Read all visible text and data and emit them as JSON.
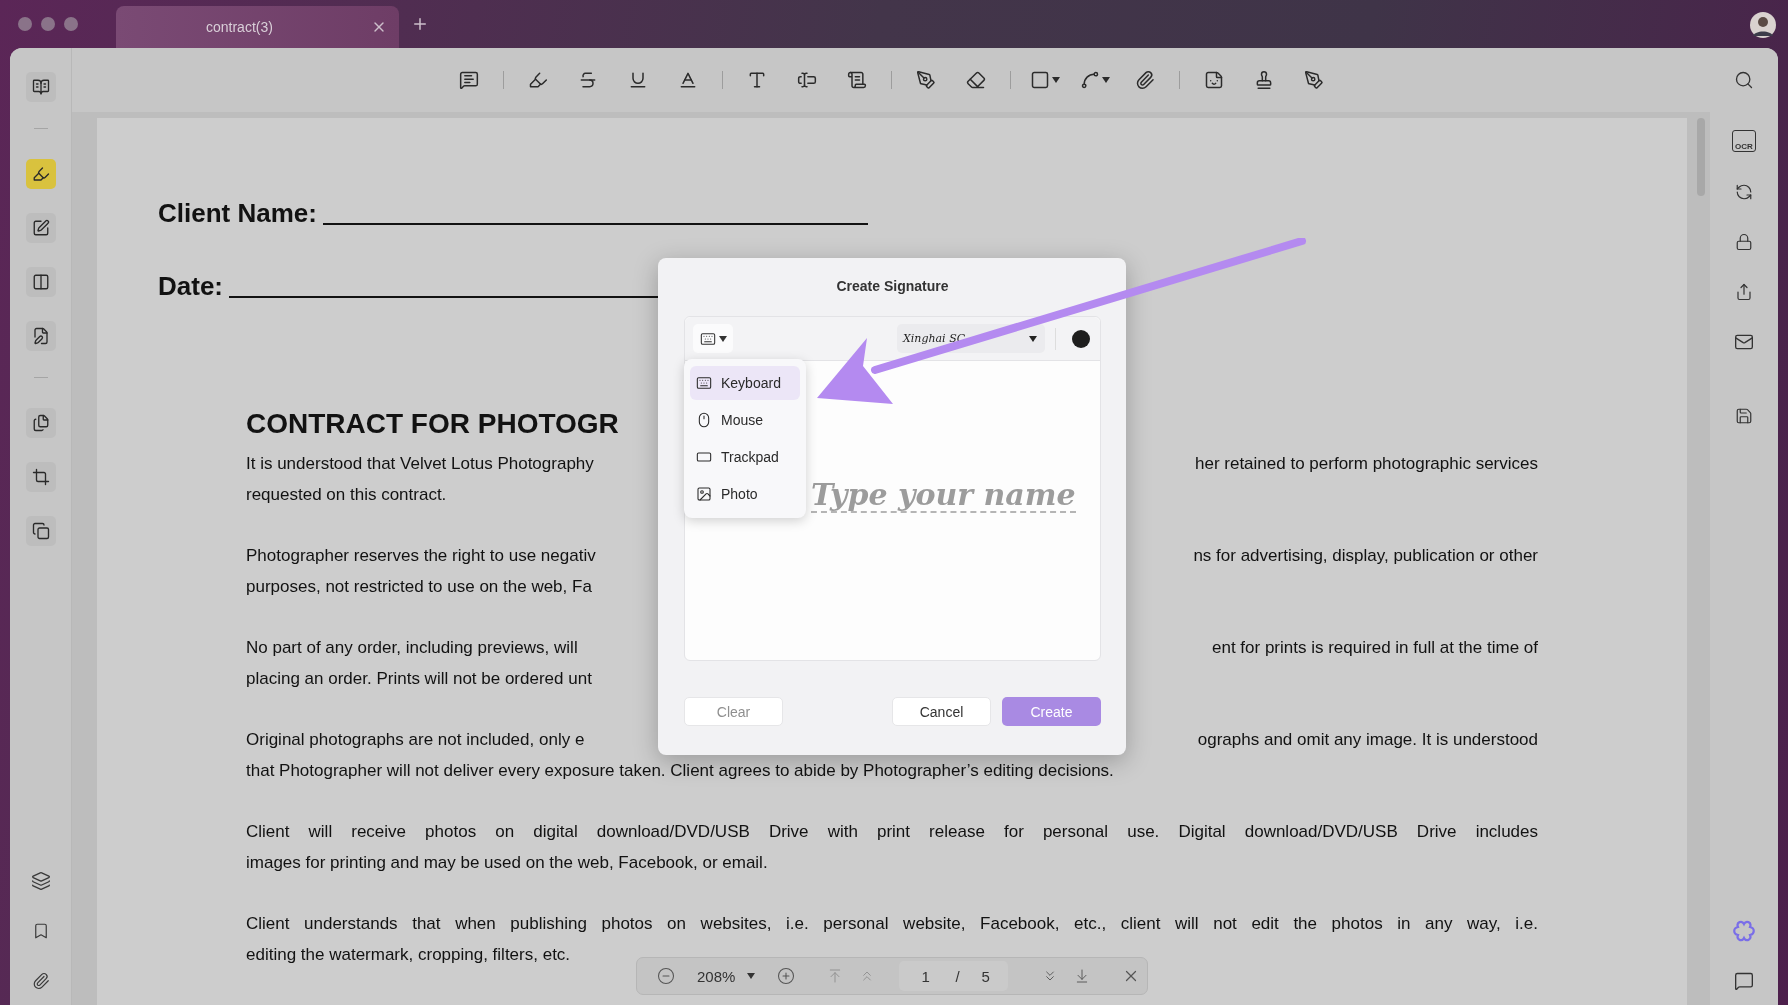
{
  "tab": {
    "title": "contract(3)"
  },
  "left_tools": [
    {
      "selected": false
    },
    {
      "selected": true
    },
    {
      "selected": false
    },
    {
      "selected": false
    },
    {
      "selected": false
    },
    {
      "selected": false
    },
    {
      "selected": false
    },
    {
      "selected": false
    }
  ],
  "document": {
    "fields": [
      {
        "label": "Client Name:"
      },
      {
        "label": "Date:"
      }
    ],
    "heading": "CONTRACT FOR PHOTOGR",
    "paragraphs": [
      {
        "lines": [
          {
            "left": "It is understood that Velvet Lotus Photography",
            "right": "her retained to perform photographic services"
          },
          {
            "left": "requested on this contract."
          }
        ]
      },
      {
        "lines": [
          {
            "left": "Photographer reserves the right to use negativ",
            "right": "ns for advertising, display, publication or other"
          },
          {
            "left": "purposes, not restricted to use on the web, Fa"
          }
        ]
      },
      {
        "lines": [
          {
            "left": "No part of any order, including previews, will",
            "right": "ent for prints is required in full at the time of"
          },
          {
            "left": "placing an order. Prints will not be ordered unt"
          }
        ]
      },
      {
        "lines": [
          {
            "left": "Original photographs are not included, only e",
            "right": "ographs and omit any image. It is understood"
          },
          {
            "left": "that Photographer will not deliver every exposure taken. Client agrees to abide by Photographer’s editing decisions."
          }
        ]
      },
      {
        "lines": [
          {
            "left": "Client will receive photos on digital download/DVD/USB Drive with print release for personal use. Digital download/DVD/USB Drive includes"
          },
          {
            "left": "images for printing and may be used on the web, Facebook, or email."
          }
        ]
      },
      {
        "lines": [
          {
            "left": "Client understands that when publishing photos on websites, i.e. personal website, Facebook, etc., client will not edit the photos in any way, i.e."
          },
          {
            "left": "editing the watermark, cropping, filters, etc."
          }
        ]
      }
    ]
  },
  "dialog": {
    "title": "Create Signature",
    "font": "Xinghai SC",
    "placeholder": "Type your name",
    "input_menu": [
      {
        "kind": "keyboard",
        "label": "Keyboard",
        "selected": true
      },
      {
        "kind": "mouse",
        "label": "Mouse",
        "selected": false
      },
      {
        "kind": "trackpad",
        "label": "Trackpad",
        "selected": false
      },
      {
        "kind": "photo",
        "label": "Photo",
        "selected": false
      }
    ],
    "buttons": [
      {
        "kind": "clear",
        "label": "Clear",
        "disabled": true
      },
      {
        "kind": "cancel",
        "label": "Cancel",
        "disabled": false
      },
      {
        "kind": "create",
        "label": "Create",
        "disabled": true
      }
    ]
  },
  "page_nav": {
    "zoom": "208%",
    "page": "1",
    "separator": "/",
    "total": "5"
  },
  "right_tools": {
    "ocr_label": "OCR"
  }
}
